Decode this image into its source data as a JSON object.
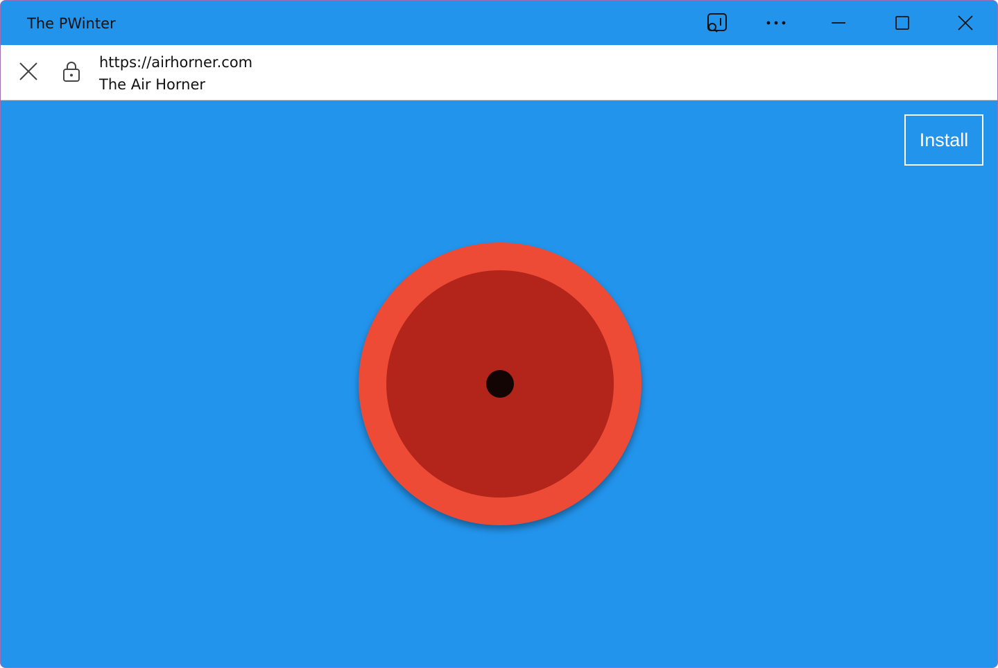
{
  "window": {
    "title": "The PWinter",
    "controls": {
      "cast_icon": "cast-search-icon",
      "more_icon": "more-horizontal-icon",
      "minimize_icon": "minimize-icon",
      "maximize_icon": "maximize-icon",
      "close_icon": "close-icon"
    }
  },
  "addressbar": {
    "close_icon": "close-icon",
    "lock_icon": "lock-icon",
    "url": "https://airhorner.com",
    "page_title": "The Air Horner"
  },
  "content": {
    "install_label": "Install",
    "background_color": "#2394ec",
    "horn": {
      "outer_color": "#ee4b37",
      "inner_color": "#b3251a",
      "center_color": "#120503"
    }
  }
}
